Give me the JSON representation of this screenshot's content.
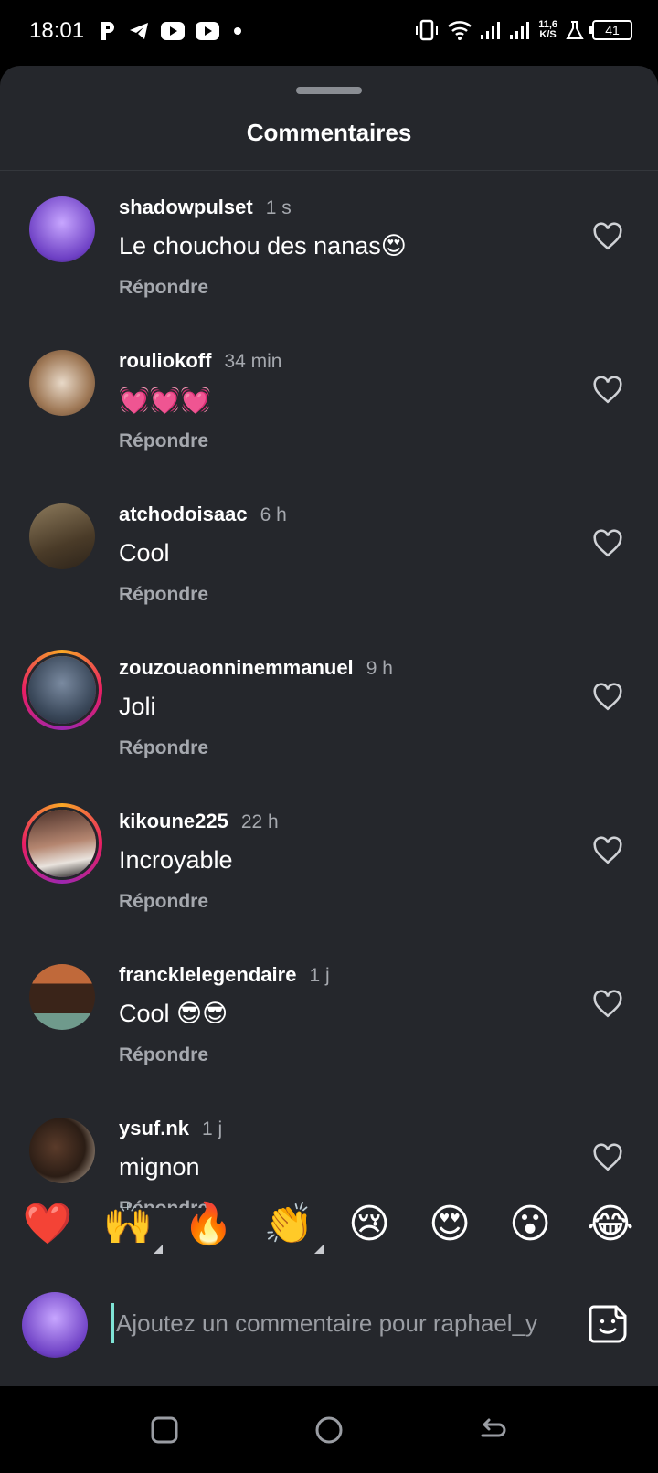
{
  "status_bar": {
    "time": "18:01",
    "network_speed": "11,6",
    "network_unit": "K/S",
    "battery": "41",
    "app_icons": [
      "p-app-icon",
      "telegram-icon",
      "youtube-icon",
      "youtube-icon",
      "dot-icon"
    ]
  },
  "sheet": {
    "title": "Commentaires"
  },
  "comments": [
    {
      "username": "shadowpulset",
      "time": "1 s",
      "text": "Le chouchou des nanas😍",
      "reply": "Répondre"
    },
    {
      "username": "rouliokoff",
      "time": "34 min",
      "text": "💓💓💓",
      "reply": "Répondre"
    },
    {
      "username": "atchodoisaac",
      "time": "6 h",
      "text": "Cool",
      "reply": "Répondre"
    },
    {
      "username": "zouzouaonninemmanuel",
      "time": "9 h",
      "text": "Joli",
      "reply": "Répondre"
    },
    {
      "username": "kikoune225",
      "time": "22 h",
      "text": "Incroyable",
      "reply": "Répondre"
    },
    {
      "username": "francklelegendaire",
      "time": "1 j",
      "text": "Cool 😎😎",
      "reply": "Répondre"
    },
    {
      "username": "ysuf.nk",
      "time": "1 j",
      "text": "mignon",
      "reply": "Répondre"
    }
  ],
  "reactions": [
    "❤️",
    "🙌",
    "🔥",
    "👏",
    "😢",
    "😍",
    "😮",
    "😂"
  ],
  "composer": {
    "placeholder": "Ajoutez un commentaire pour raphael_y"
  },
  "colors": {
    "sheet_bg": "#25272c",
    "text_secondary": "#a5a8ae",
    "story_ring_start": "#f9a825",
    "story_ring_end": "#9c27b0"
  }
}
